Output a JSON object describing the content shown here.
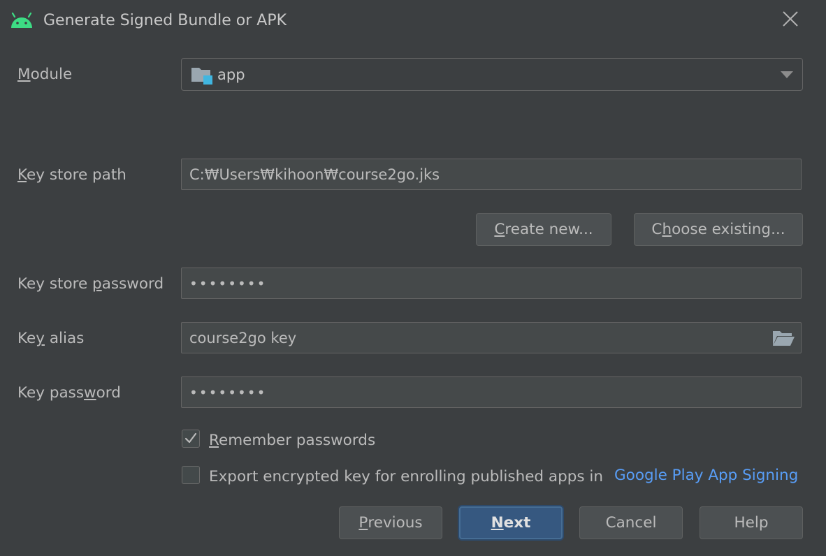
{
  "dialog": {
    "title": "Generate Signed Bundle or APK",
    "icon": "android-icon",
    "accent_color": "#3ddc84"
  },
  "module": {
    "label_first": "M",
    "label_rest": "odule",
    "value": "app",
    "icon": "module-folder-icon"
  },
  "key_store_path": {
    "label_first": "K",
    "label_rest": "ey store path",
    "value": "C:₩Users₩kihoon₩course2go.jks"
  },
  "buttons": {
    "create_new_u": "C",
    "create_new_rest": "reate new...",
    "choose_existing_pre": "C",
    "choose_existing_u": "h",
    "choose_existing_rest": "oose existing..."
  },
  "key_store_password": {
    "label_pre": "Key store ",
    "label_u": "p",
    "label_rest": "assword",
    "value": "••••••••"
  },
  "key_alias": {
    "label_pre": "Ke",
    "label_u": "y",
    "label_rest": " alias",
    "value": "course2go key",
    "icon": "folder-open-icon"
  },
  "key_password": {
    "label_pre": "Key pass",
    "label_u": "w",
    "label_rest": "ord",
    "value": "••••••••"
  },
  "remember": {
    "label_u": "R",
    "label_rest": "emember passwords",
    "checked": true
  },
  "export": {
    "label": "Export encrypted key for enrolling published apps in",
    "link": "Google Play App Signing",
    "checked": false
  },
  "footer": {
    "previous_u": "P",
    "previous_rest": "revious",
    "next_u": "N",
    "next_rest": "ext",
    "cancel": "Cancel",
    "help": "Help"
  }
}
